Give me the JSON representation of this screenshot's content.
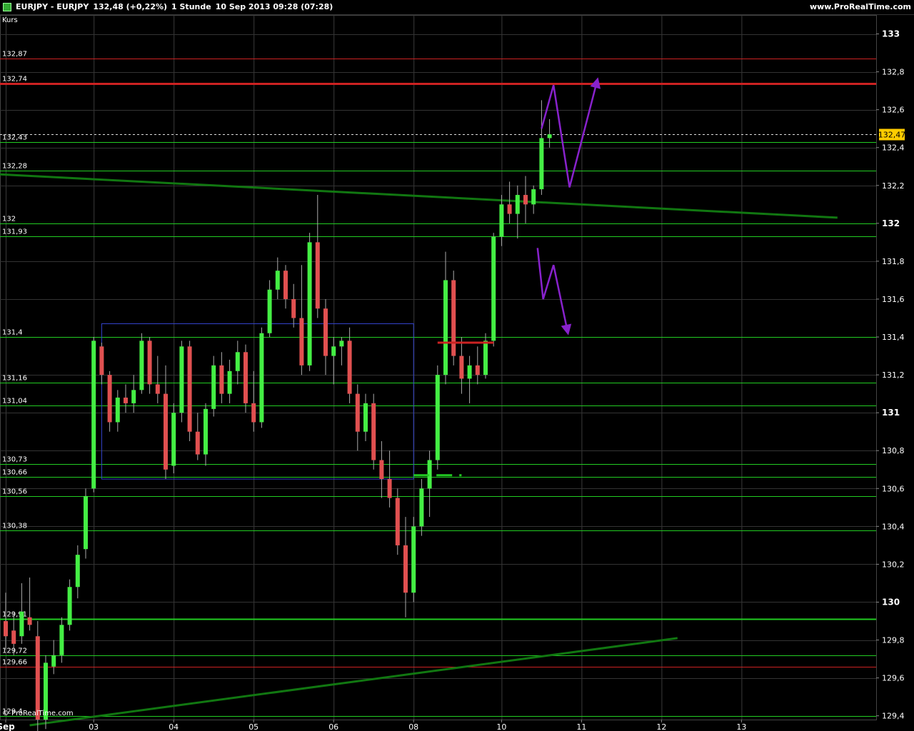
{
  "header": {
    "symbol": "EURJPY - EURJPY",
    "quote": "132,48 (+0,22%)",
    "timeframe": "1 Stunde",
    "datetime": "10 Sep 2013 09:28 (07:28)",
    "site": "www.ProRealTime.com"
  },
  "panel_label": "Kurs",
  "copyright": "© ProRealTime.com",
  "last_price_tag": "132,47",
  "colors": {
    "bull": "#44ee44",
    "bear": "#e05050",
    "support": "#22cc22",
    "resistance": "#cc2222",
    "trend": "#117711",
    "projection": "#8822cc",
    "box": "#3344cc"
  },
  "chart_data": {
    "type": "candlestick",
    "ylim": [
      129.38,
      133.1
    ],
    "y_ticks": [
      {
        "v": 133,
        "label": "133",
        "bold": true
      },
      {
        "v": 132.8,
        "label": "132,8"
      },
      {
        "v": 132.6,
        "label": "132,6"
      },
      {
        "v": 132.4,
        "label": "132,4"
      },
      {
        "v": 132.2,
        "label": "132,2"
      },
      {
        "v": 132,
        "label": "132",
        "bold": true
      },
      {
        "v": 131.8,
        "label": "131,8"
      },
      {
        "v": 131.6,
        "label": "131,6"
      },
      {
        "v": 131.4,
        "label": "131,4"
      },
      {
        "v": 131.2,
        "label": "131,2"
      },
      {
        "v": 131,
        "label": "131",
        "bold": true
      },
      {
        "v": 130.8,
        "label": "130,8"
      },
      {
        "v": 130.6,
        "label": "130,6"
      },
      {
        "v": 130.4,
        "label": "130,4"
      },
      {
        "v": 130.2,
        "label": "130,2"
      },
      {
        "v": 130,
        "label": "130",
        "bold": true
      },
      {
        "v": 129.8,
        "label": "129,8"
      },
      {
        "v": 129.6,
        "label": "129,6"
      },
      {
        "v": 129.4,
        "label": "129,4"
      }
    ],
    "x_ticks": [
      {
        "label": "Sep",
        "idx": 0,
        "bold": true
      },
      {
        "label": "03",
        "idx": 11
      },
      {
        "label": "04",
        "idx": 21
      },
      {
        "label": "05",
        "idx": 31
      },
      {
        "label": "06",
        "idx": 41
      },
      {
        "label": "08",
        "idx": 51
      },
      {
        "label": "10",
        "idx": 62
      },
      {
        "label": "11",
        "idx": 72
      },
      {
        "label": "12",
        "idx": 82
      },
      {
        "label": "13",
        "idx": 92
      }
    ],
    "horizontal_levels": [
      {
        "v": 132.87,
        "label": "132,87",
        "color": "resistance",
        "width": 1
      },
      {
        "v": 132.74,
        "label": "132,74",
        "color": "resistance",
        "width": 3
      },
      {
        "v": 132.43,
        "label": "132,43",
        "color": "support",
        "width": 1
      },
      {
        "v": 132.28,
        "label": "132,28",
        "color": "support",
        "width": 1
      },
      {
        "v": 132,
        "label": "132",
        "color": "support",
        "width": 1
      },
      {
        "v": 131.93,
        "label": "131,93",
        "color": "support",
        "width": 1
      },
      {
        "v": 131.4,
        "label": "131,4",
        "color": "support",
        "width": 1
      },
      {
        "v": 131.16,
        "label": "131,16",
        "color": "support",
        "width": 1
      },
      {
        "v": 131.04,
        "label": "131,04",
        "color": "support",
        "width": 1
      },
      {
        "v": 130.73,
        "label": "130,73",
        "color": "support",
        "width": 1
      },
      {
        "v": 130.66,
        "label": "130,66",
        "color": "support",
        "width": 1
      },
      {
        "v": 130.56,
        "label": "130,56",
        "color": "support",
        "width": 1
      },
      {
        "v": 130.38,
        "label": "130,38",
        "color": "support",
        "width": 1
      },
      {
        "v": 129.91,
        "label": "129,91",
        "color": "support",
        "width": 2
      },
      {
        "v": 129.72,
        "label": "129,72",
        "color": "support",
        "width": 1
      },
      {
        "v": 129.66,
        "label": "129,66",
        "color": "resistance",
        "width": 1
      },
      {
        "v": 129.4,
        "label": "129,4",
        "color": "support",
        "width": 1
      }
    ],
    "last_price": 132.47,
    "trendlines": [
      {
        "from": {
          "idx": -6,
          "v": 132.27
        },
        "to": {
          "idx": 104,
          "v": 132.03
        }
      },
      {
        "from": {
          "idx": 3,
          "v": 129.35
        },
        "to": {
          "idx": 84,
          "v": 129.81
        }
      }
    ],
    "range_box": {
      "from_idx": 12,
      "to_idx": 51,
      "top": 131.47,
      "bottom": 130.65
    },
    "short_marks": [
      {
        "from_idx": 54,
        "to_idx": 61,
        "v": 131.37,
        "color": "resistance"
      },
      {
        "from_idx": 51,
        "to_idx": 57,
        "v": 130.67,
        "color": "support",
        "dashed": true
      }
    ],
    "projections": [
      [
        {
          "idx": 67,
          "v": 132.5
        },
        {
          "idx": 68.5,
          "v": 132.73
        },
        {
          "idx": 70.5,
          "v": 132.19
        },
        {
          "idx": 74,
          "v": 132.76
        }
      ],
      [
        {
          "idx": 66.5,
          "v": 131.87
        },
        {
          "idx": 67.2,
          "v": 131.6
        },
        {
          "idx": 68.5,
          "v": 131.78
        },
        {
          "idx": 70.3,
          "v": 131.42
        }
      ]
    ],
    "candles": [
      [
        129.9,
        130.05,
        129.75,
        129.82
      ],
      [
        129.85,
        129.95,
        129.72,
        129.78
      ],
      [
        129.82,
        130.1,
        129.78,
        129.95
      ],
      [
        129.92,
        130.13,
        129.85,
        129.88
      ],
      [
        129.82,
        129.9,
        129.3,
        129.38
      ],
      [
        129.38,
        129.72,
        129.33,
        129.68
      ],
      [
        129.66,
        129.8,
        129.62,
        129.72
      ],
      [
        129.72,
        129.92,
        129.68,
        129.88
      ],
      [
        129.88,
        130.12,
        129.85,
        130.08
      ],
      [
        130.08,
        130.3,
        130.02,
        130.25
      ],
      [
        130.28,
        130.6,
        130.23,
        130.56
      ],
      [
        130.6,
        131.4,
        130.58,
        131.38
      ],
      [
        131.35,
        131.37,
        131.15,
        131.2
      ],
      [
        131.2,
        131.22,
        130.9,
        130.95
      ],
      [
        130.95,
        131.12,
        130.9,
        131.08
      ],
      [
        131.08,
        131.15,
        131.0,
        131.05
      ],
      [
        131.05,
        131.2,
        131.0,
        131.12
      ],
      [
        131.12,
        131.42,
        131.1,
        131.38
      ],
      [
        131.38,
        131.4,
        131.1,
        131.15
      ],
      [
        131.15,
        131.3,
        131.05,
        131.1
      ],
      [
        131.1,
        131.25,
        130.65,
        130.7
      ],
      [
        130.72,
        131.05,
        130.68,
        131.0
      ],
      [
        131.0,
        131.38,
        130.95,
        131.35
      ],
      [
        131.35,
        131.38,
        130.85,
        130.9
      ],
      [
        130.9,
        131.0,
        130.75,
        130.78
      ],
      [
        130.78,
        131.05,
        130.72,
        131.02
      ],
      [
        131.02,
        131.3,
        130.98,
        131.25
      ],
      [
        131.25,
        131.32,
        131.05,
        131.1
      ],
      [
        131.1,
        131.28,
        131.05,
        131.22
      ],
      [
        131.22,
        131.38,
        131.15,
        131.32
      ],
      [
        131.32,
        131.36,
        131.0,
        131.05
      ],
      [
        131.05,
        131.22,
        130.9,
        130.95
      ],
      [
        130.95,
        131.45,
        130.92,
        131.42
      ],
      [
        131.42,
        131.7,
        131.4,
        131.65
      ],
      [
        131.65,
        131.82,
        131.6,
        131.75
      ],
      [
        131.75,
        131.78,
        131.55,
        131.6
      ],
      [
        131.6,
        131.68,
        131.45,
        131.5
      ],
      [
        131.5,
        131.78,
        131.2,
        131.25
      ],
      [
        131.25,
        131.95,
        131.22,
        131.9
      ],
      [
        131.9,
        132.15,
        131.5,
        131.55
      ],
      [
        131.55,
        131.6,
        131.2,
        131.3
      ],
      [
        131.3,
        131.4,
        131.15,
        131.35
      ],
      [
        131.35,
        131.4,
        131.25,
        131.38
      ],
      [
        131.38,
        131.45,
        131.05,
        131.1
      ],
      [
        131.1,
        131.15,
        130.8,
        130.9
      ],
      [
        130.9,
        131.1,
        130.85,
        131.05
      ],
      [
        131.05,
        131.1,
        130.7,
        130.75
      ],
      [
        130.75,
        130.85,
        130.55,
        130.65
      ],
      [
        130.65,
        130.8,
        130.5,
        130.55
      ],
      [
        130.55,
        130.6,
        130.25,
        130.3
      ],
      [
        130.3,
        130.45,
        129.92,
        130.05
      ],
      [
        130.05,
        130.45,
        130.0,
        130.4
      ],
      [
        130.4,
        130.65,
        130.35,
        130.6
      ],
      [
        130.6,
        130.8,
        130.45,
        130.75
      ],
      [
        130.75,
        131.25,
        130.7,
        131.2
      ],
      [
        131.2,
        131.85,
        131.15,
        131.7
      ],
      [
        131.7,
        131.75,
        131.25,
        131.3
      ],
      [
        131.3,
        131.4,
        131.1,
        131.18
      ],
      [
        131.18,
        131.3,
        131.05,
        131.25
      ],
      [
        131.25,
        131.35,
        131.15,
        131.2
      ],
      [
        131.2,
        131.42,
        131.18,
        131.38
      ],
      [
        131.38,
        131.95,
        131.35,
        131.93
      ],
      [
        131.93,
        132.15,
        131.88,
        132.1
      ],
      [
        132.1,
        132.22,
        132.0,
        132.05
      ],
      [
        132.05,
        132.2,
        131.92,
        132.15
      ],
      [
        132.15,
        132.25,
        132.0,
        132.1
      ],
      [
        132.1,
        132.2,
        132.05,
        132.18
      ],
      [
        132.18,
        132.65,
        132.15,
        132.45
      ],
      [
        132.45,
        132.55,
        132.4,
        132.47
      ]
    ]
  }
}
